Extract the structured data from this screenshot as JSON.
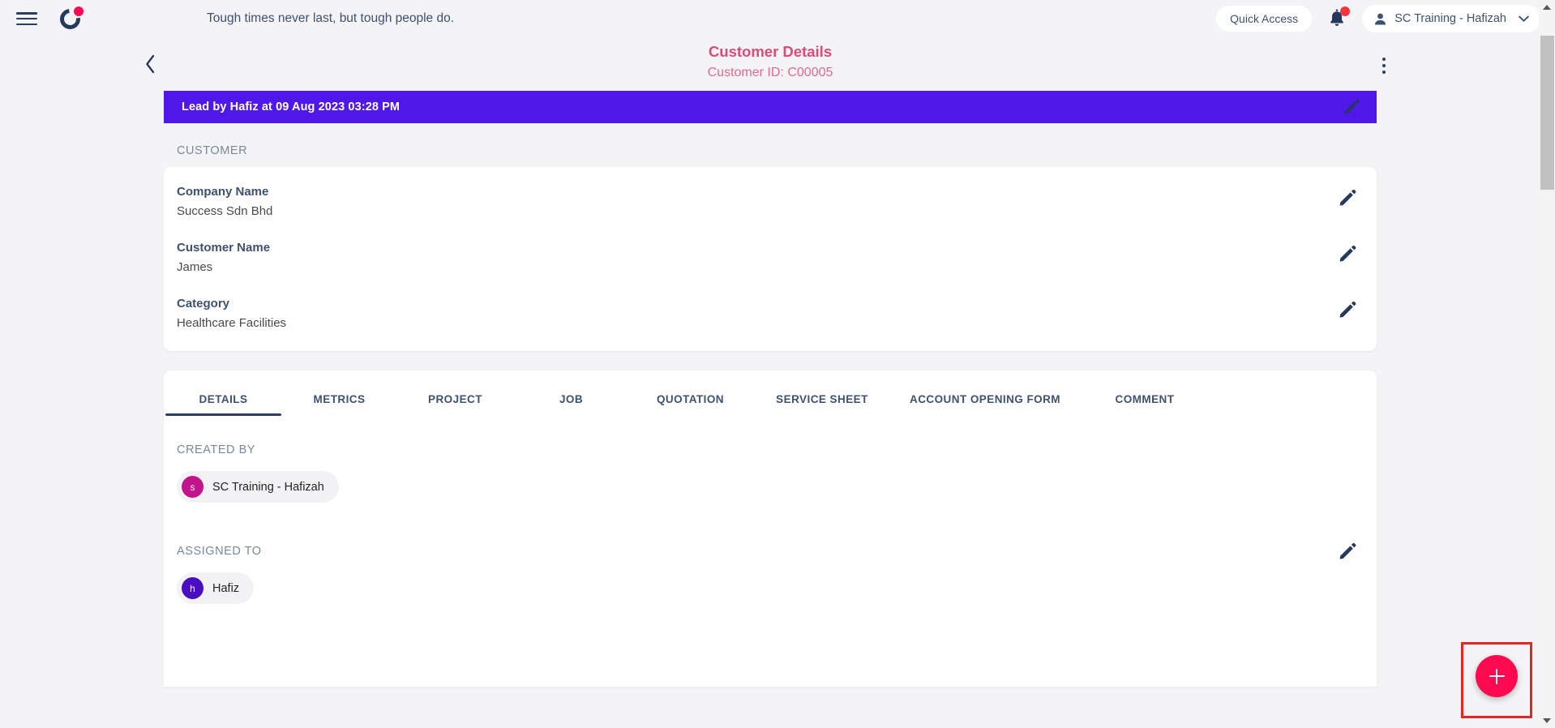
{
  "topbar": {
    "menu_icon": "hamburger-icon",
    "logo_icon": "brand-logo-icon",
    "quote": "Tough times never last, but tough people do.",
    "quick_access_label": "Quick Access",
    "notification_icon": "bell-icon",
    "notification_badge": "",
    "user_name": "SC Training - Hafizah",
    "user_icon": "person-icon",
    "chevron": "⌄"
  },
  "page_header": {
    "back_icon": "chevron-left-icon",
    "title": "Customer Details",
    "subtitle": "Customer ID: C00005",
    "kebab_icon": "more-vertical-icon",
    "title_color": "#dd4b77",
    "subtitle_color": "#e4688f"
  },
  "lead_banner": {
    "text": "Lead by Hafiz at 09 Aug 2023 03:28 PM",
    "background": "#5018e8",
    "edit_icon": "pencil-icon"
  },
  "customer_section": {
    "label": "CUSTOMER",
    "fields": [
      {
        "label": "Company Name",
        "value": "Success Sdn Bhd",
        "edit_icon": "pencil-icon"
      },
      {
        "label": "Customer Name",
        "value": "James",
        "edit_icon": "pencil-icon"
      },
      {
        "label": "Category",
        "value": "Healthcare Facilities",
        "edit_icon": "pencil-icon"
      }
    ]
  },
  "tabs": {
    "active_index": 0,
    "items": [
      {
        "label": "DETAILS"
      },
      {
        "label": "METRICS"
      },
      {
        "label": "PROJECT"
      },
      {
        "label": "JOB"
      },
      {
        "label": "QUOTATION"
      },
      {
        "label": "SERVICE SHEET"
      },
      {
        "label": "ACCOUNT OPENING FORM"
      },
      {
        "label": "COMMENT"
      }
    ]
  },
  "details_pane": {
    "created_by": {
      "label": "CREATED BY",
      "person": {
        "initial": "S",
        "name": "SC Training - Hafizah",
        "avatar_color": "#c2158c"
      }
    },
    "assigned_to": {
      "label": "ASSIGNED TO",
      "edit_icon": "pencil-icon",
      "person": {
        "initial": "H",
        "name": "Hafiz",
        "avatar_color": "#4a0ec2"
      }
    }
  },
  "fab": {
    "icon": "plus-icon",
    "color": "#fb0a50",
    "highlight_color": "#e5261f"
  },
  "scrollbar": {
    "up_icon": "triangle-up-icon",
    "down_icon": "triangle-down-icon",
    "thumb_color": "#c1c1c1"
  }
}
